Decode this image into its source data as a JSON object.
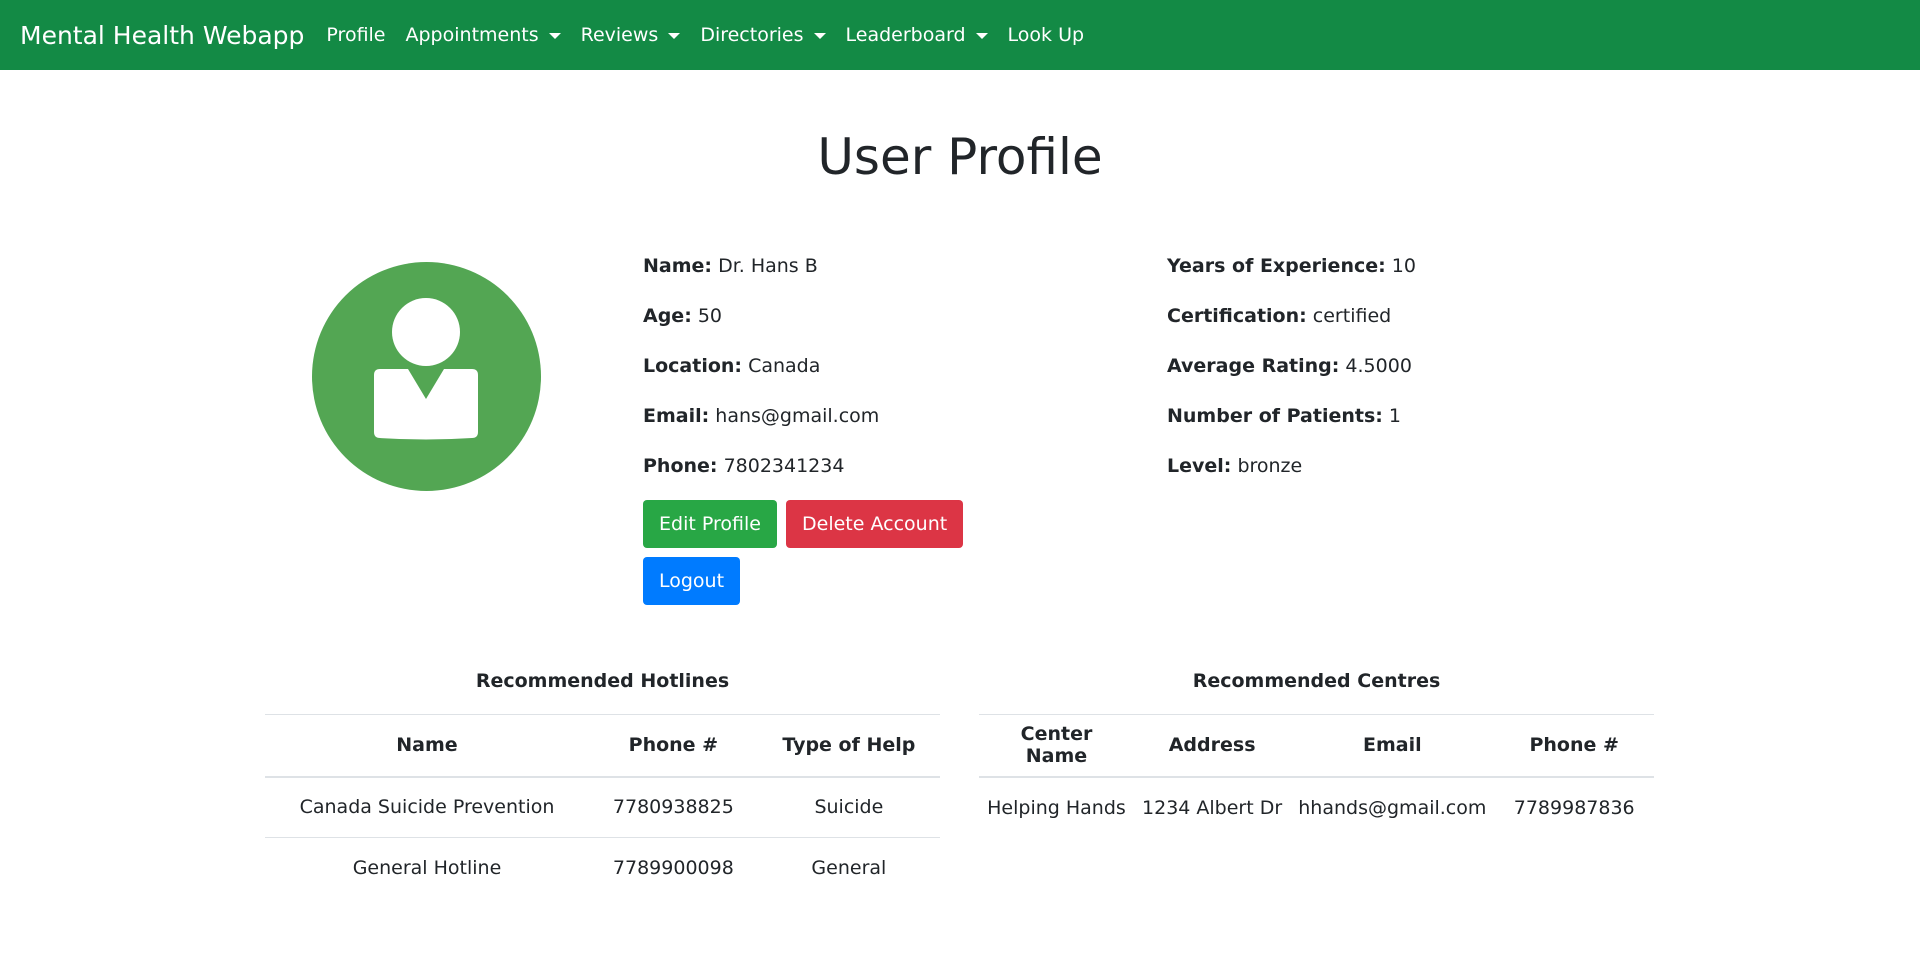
{
  "navbar": {
    "brand": "Mental Health Webapp",
    "items": [
      {
        "label": "Profile"
      },
      {
        "label": "Appointments"
      },
      {
        "label": "Reviews"
      },
      {
        "label": "Directories"
      },
      {
        "label": "Leaderboard"
      },
      {
        "label": "Look Up"
      }
    ],
    "color": "#138a45"
  },
  "page_title": "User Profile",
  "avatar": {
    "icon": "user-avatar-icon",
    "color": "#53a653"
  },
  "profile": {
    "left": [
      {
        "label": "Name:",
        "value": "Dr. Hans B"
      },
      {
        "label": "Age:",
        "value": "50"
      },
      {
        "label": "Location:",
        "value": "Canada"
      },
      {
        "label": "Email:",
        "value": "hans@gmail.com"
      },
      {
        "label": "Phone:",
        "value": "7802341234"
      }
    ],
    "right": [
      {
        "label": "Years of Experience:",
        "value": "10"
      },
      {
        "label": "Certification:",
        "value": "certified"
      },
      {
        "label": "Average Rating:",
        "value": "4.5000"
      },
      {
        "label": "Number of Patients:",
        "value": "1"
      },
      {
        "label": "Level:",
        "value": "bronze"
      }
    ]
  },
  "buttons": {
    "edit": "Edit Profile",
    "delete": "Delete Account",
    "logout": "Logout"
  },
  "hotlines": {
    "title": "Recommended Hotlines",
    "headers": [
      "Name",
      "Phone #",
      "Type of Help"
    ],
    "rows": [
      [
        "Canada Suicide Prevention",
        "7780938825",
        "Suicide"
      ],
      [
        "General Hotline",
        "7789900098",
        "General"
      ]
    ]
  },
  "centres": {
    "title": "Recommended Centres",
    "headers": [
      "Center Name",
      "Address",
      "Email",
      "Phone #"
    ],
    "rows": [
      [
        "Helping Hands",
        "1234 Albert Dr",
        "hhands@gmail.com",
        "7789987836"
      ]
    ]
  }
}
